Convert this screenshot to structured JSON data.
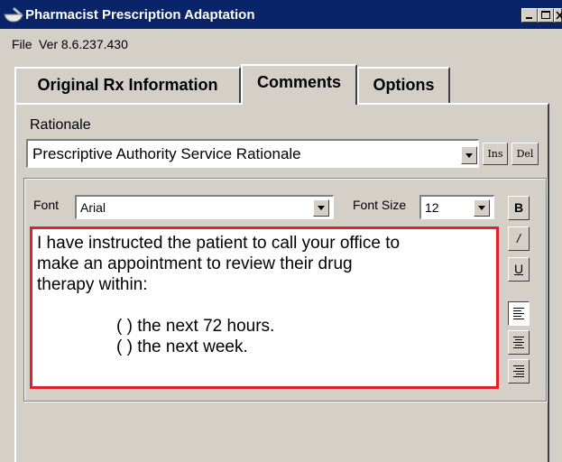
{
  "window": {
    "title": "Pharmacist Prescription Adaptation",
    "icon": "mortar-pestle-icon",
    "title_bar_color": "#0a246a"
  },
  "menu": {
    "file_label": "File",
    "version_label": "Ver 8.6.237.430"
  },
  "tabs": [
    {
      "label": "Original Rx Information",
      "selected": false
    },
    {
      "label": "Comments",
      "selected": true
    },
    {
      "label": "Options",
      "selected": false
    }
  ],
  "rationale": {
    "label": "Rationale",
    "selected_value": "Prescriptive Authority Service Rationale",
    "ins_label": "Ins",
    "del_label": "Del"
  },
  "formatting": {
    "font_label": "Font",
    "font_value": "Arial",
    "font_size_label": "Font Size",
    "font_size_value": "12",
    "bold_label": "B",
    "italic_label": "/",
    "underline_label": "U",
    "align_left_icon": "align-left-icon",
    "align_center_icon": "align-center-icon",
    "align_right_icon": "align-right-icon"
  },
  "comment_text": {
    "lines": [
      "I have instructed the patient to call your office to",
      "make an appointment to review their drug",
      "therapy within:",
      "",
      "( ) the next 72 hours.",
      "( ) the next week."
    ],
    "highlight_color": "#e0202a"
  }
}
